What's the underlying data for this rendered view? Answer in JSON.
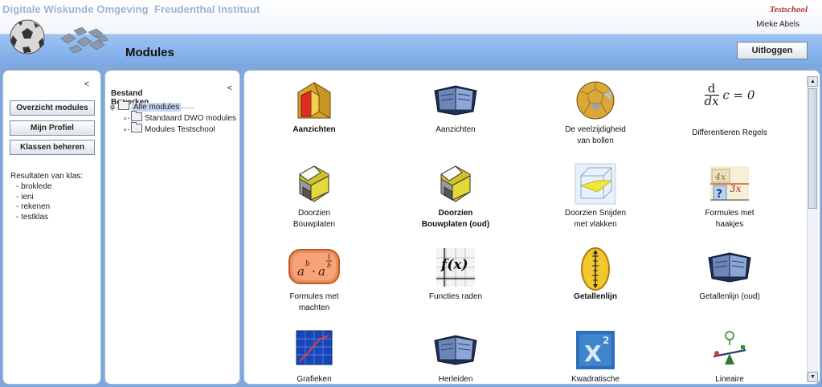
{
  "header": {
    "app_title": "Digitale Wiskunde Omgeving  Freudenthal Instituut",
    "school": "Testschool",
    "user": "Mieke Abels",
    "page_title": "Modules",
    "logout_label": "Uitloggen"
  },
  "left_panel": {
    "collapse": "<",
    "buttons": [
      "Overzicht modules",
      "Mijn Profiel",
      "Klassen beheren"
    ],
    "results_label": "Resultaten van klas:",
    "classes": [
      "-  broklede",
      "-  ieni",
      "-  rekenen",
      "-  testklas"
    ]
  },
  "tree_panel": {
    "collapse": "<",
    "menu": [
      "Bestand",
      "Bewerken"
    ],
    "nodes": [
      {
        "label": "Alle modules",
        "toggle": "φ"
      },
      {
        "label": "Standaard DWO modules",
        "toggle": "∘-"
      },
      {
        "label": "Modules Testschool",
        "toggle": "∘-"
      }
    ]
  },
  "modules": [
    {
      "title": "Aanzichten",
      "icon": "red-prism-icon"
    },
    {
      "title": "Aanzichten",
      "icon": "book-icon"
    },
    {
      "title": "De veelzijdigheid van bollen",
      "line1": "De veelzijdigheid",
      "line2": "van bollen",
      "icon": "polyhedron-ball-icon"
    },
    {
      "title": "Differentieren Regels",
      "icon": "derivative-formula-icon",
      "formula_top": "d",
      "formula_bottom": "dx",
      "formula_rest": "c = 0"
    },
    {
      "title": "Doorzien Bouwplaten",
      "line1": "Doorzien",
      "line2": "Bouwplaten",
      "icon": "yellow-cube-icon"
    },
    {
      "title": "Doorzien Bouwplaten (oud)",
      "line1": "Doorzien",
      "line2": "Bouwplaten (oud)",
      "icon": "yellow-cube-icon"
    },
    {
      "title": "Doorzien Snijden met vlakken",
      "line1": "Doorzien Snijden",
      "line2": "met vlakken",
      "icon": "cube-section-icon"
    },
    {
      "title": "Formules met haakjes",
      "line1": "Formules met",
      "line2": "haakjes",
      "icon": "formula-card-icon",
      "card_a": "4x",
      "card_b": "3x",
      "card_q": "?"
    },
    {
      "title": "Formules met machten",
      "line1": "Formules met",
      "line2": "machten",
      "icon": "power-formula-icon"
    },
    {
      "title": "Functies raden",
      "icon": "function-graph-icon",
      "fx": "f(x)"
    },
    {
      "title": "Getallenlijn",
      "icon": "number-line-icon"
    },
    {
      "title": "Getallenlijn (oud)",
      "icon": "book-icon"
    },
    {
      "title": "Grafieken",
      "icon": "graph-chart-icon"
    },
    {
      "title": "Herleiden",
      "icon": "book-icon"
    },
    {
      "title": "Kwadratische",
      "icon": "x-squared-icon",
      "x_letter": "X",
      "x_exp": "2"
    },
    {
      "title": "Lineaire",
      "icon": "balance-scale-icon"
    }
  ],
  "colors": {
    "header_bar": "#7daae6",
    "app_title": "#9db4d5",
    "school": "#b8322a",
    "panel_border": "#a7b9d2"
  }
}
